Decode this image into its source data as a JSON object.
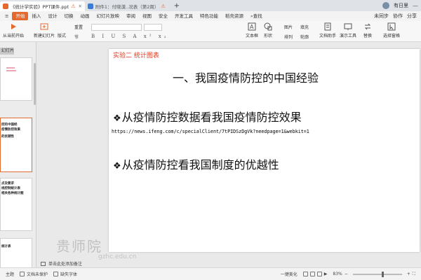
{
  "tabs": [
    {
      "label": "《统计学实验》PPT课件.ppt",
      "color": "#e3692c"
    },
    {
      "label": "附件1：付晓漠..况表（第2周）",
      "color": "#3a7bd5"
    }
  ],
  "tab_plus": "+",
  "titlebar_right": {
    "login_text": "有日里"
  },
  "menu": {
    "items": [
      "开始",
      "插入",
      "设计",
      "切换",
      "动画",
      "幻灯片放映",
      "审阅",
      "视图",
      "安全",
      "开发工具",
      "特色功能",
      "稻壳资源"
    ],
    "search": "查找",
    "right_items": [
      "未同步",
      "协作",
      "分享"
    ]
  },
  "ribbon": {
    "play_from_current": "从当前开始",
    "new_slide": "新建幻灯片",
    "layout": "版式",
    "reset": "重置",
    "section": "节",
    "format_chars": "B I U S A x² x₂",
    "textbox": "文本框",
    "shape": "形状",
    "arrange": "排列",
    "image": "图片",
    "fill": "填充",
    "outline": "轮廓",
    "text_assistant": "文档助手",
    "presenter_tools": "演示工具",
    "replace": "替换",
    "select_pane": "选择窗格"
  },
  "leftpanel": {
    "tab_label": "幻灯片",
    "thumbs": [
      {
        "lines": []
      },
      {
        "lines": [
          "控的中国经",
          "疫情防控效果",
          "的优越性"
        ]
      },
      {
        "lines": [
          "点及要求",
          "线控制统计表",
          "相关各种统计图"
        ]
      },
      {
        "lines": [
          "统计表"
        ]
      }
    ]
  },
  "slide": {
    "label": "实验二  统计图表",
    "title": "一、我国疫情防控的中国经验",
    "bullet1": "从疫情防控数据看我国疫情防控效果",
    "url": "https://news.ifeng.com/c/specialClient/7tPIDSzDgVk?needpage=1&webkit=1",
    "bullet2": "从疫情防控看我国制度的优越性",
    "bullet_glyph": "❖"
  },
  "notes_placeholder": "单击此处添加备注",
  "watermark": {
    "text": "贵师院",
    "sub": "gzhc.edu.cn"
  },
  "statusbar": {
    "theme": "主题",
    "doc_protect": "文档未保护",
    "missing_font": "缺失字体",
    "beautify": "一键美化",
    "zoom": "83%",
    "zoom_fraction": 0.62
  }
}
